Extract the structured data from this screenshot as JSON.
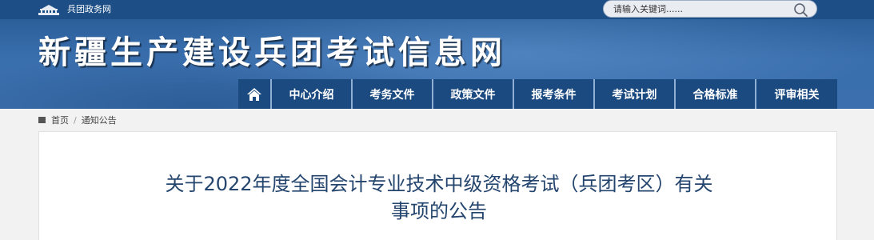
{
  "topbar": {
    "gov_link_label": "兵团政务网",
    "search_placeholder": "请输入关键词......"
  },
  "header": {
    "site_title": "新疆生产建设兵团考试信息网"
  },
  "nav": {
    "items": [
      {
        "label": "中心介绍"
      },
      {
        "label": "考务文件"
      },
      {
        "label": "政策文件"
      },
      {
        "label": "报考条件"
      },
      {
        "label": "考试计划"
      },
      {
        "label": "合格标准"
      },
      {
        "label": "评审相关"
      }
    ]
  },
  "breadcrumb": {
    "home": "首页",
    "separator": "/",
    "current": "通知公告"
  },
  "article": {
    "title_line1": "关于2022年度全国会计专业技术中级资格考试（兵团考区）有关",
    "title_line2": "事项的公告"
  },
  "colors": {
    "topbar": "#1d4f86",
    "nav_bg": "#1a4a80",
    "title_text": "#24456e"
  }
}
